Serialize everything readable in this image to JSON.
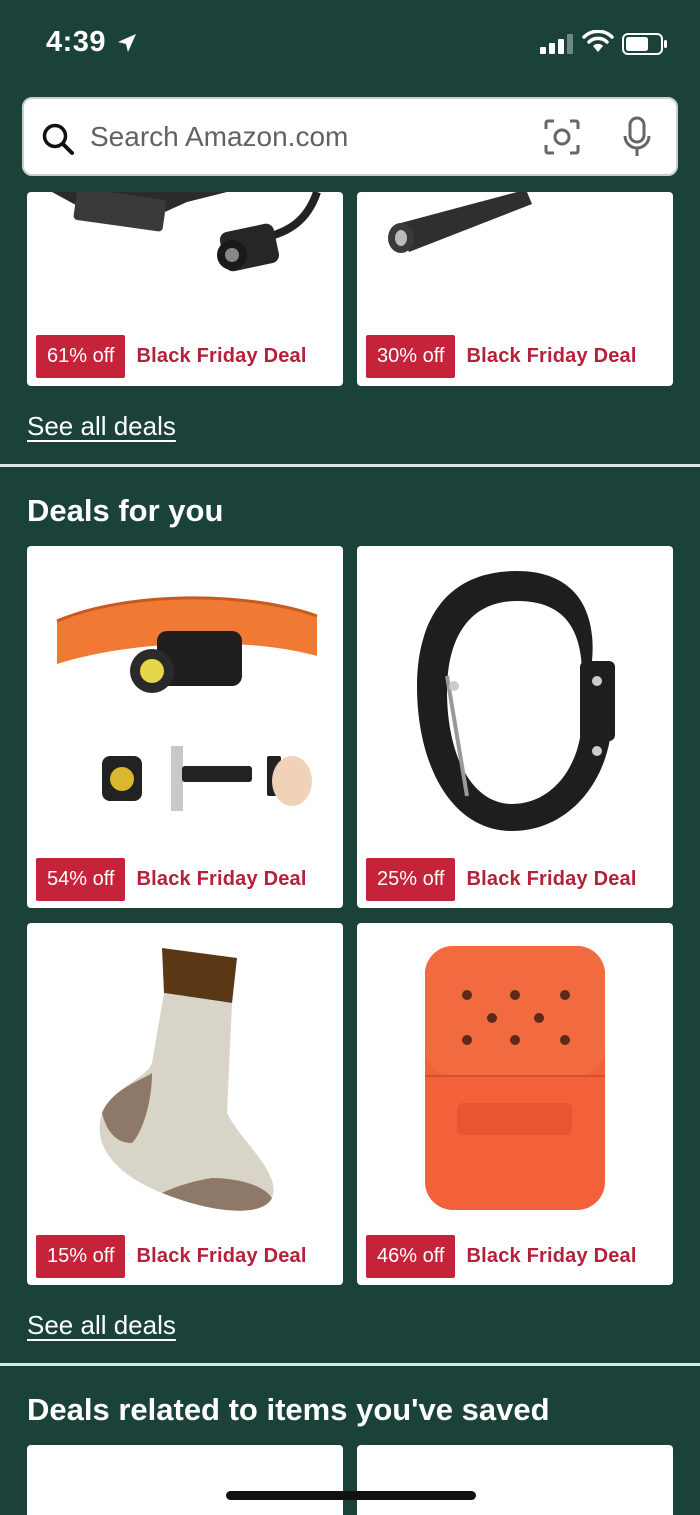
{
  "status_bar": {
    "time": "4:39"
  },
  "search": {
    "placeholder": "Search Amazon.com"
  },
  "top_section": {
    "cards": [
      {
        "discount": "61% off",
        "deal": "Black Friday Deal",
        "image": "flashlight-gooseneck-image"
      },
      {
        "discount": "30% off",
        "deal": "Black Friday Deal",
        "image": "penlight-image"
      }
    ],
    "see_all": "See all deals"
  },
  "deals_for_you": {
    "title": "Deals for you",
    "cards": [
      {
        "discount": "54% off",
        "deal": "Black Friday Deal",
        "image": "headlamp-image"
      },
      {
        "discount": "25% off",
        "deal": "Black Friday Deal",
        "image": "heroclip-carabiner-image"
      },
      {
        "discount": "15% off",
        "deal": "Black Friday Deal",
        "image": "wool-sock-image"
      },
      {
        "discount": "46% off",
        "deal": "Black Friday Deal",
        "image": "zippo-hand-warmer-image"
      }
    ],
    "see_all": "See all deals"
  },
  "saved_section": {
    "title": "Deals related to items you've saved"
  },
  "colors": {
    "background": "#1a4238",
    "badge": "#c4233a",
    "deal_text": "#b3213a"
  }
}
